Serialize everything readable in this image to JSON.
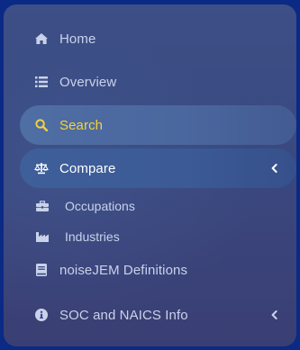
{
  "sidebar": {
    "items": [
      {
        "label": "Home",
        "icon": "home-icon"
      },
      {
        "label": "Overview",
        "icon": "list-icon"
      },
      {
        "label": "Search",
        "icon": "search-icon",
        "state": "active"
      },
      {
        "label": "Compare",
        "icon": "balance-scale-icon",
        "state": "expanded"
      },
      {
        "label": "noiseJEM Definitions",
        "icon": "book-icon"
      },
      {
        "label": "SOC and NAICS Info",
        "icon": "info-circle-icon"
      }
    ],
    "compare_subitems": [
      {
        "label": "Occupations",
        "icon": "briefcase-icon"
      },
      {
        "label": "Industries",
        "icon": "industry-icon"
      }
    ]
  },
  "colors": {
    "frame": "#0a2a86",
    "sidebar": "#3a4a82",
    "active_text": "#f3d23c",
    "text": "#c9d2ea"
  }
}
